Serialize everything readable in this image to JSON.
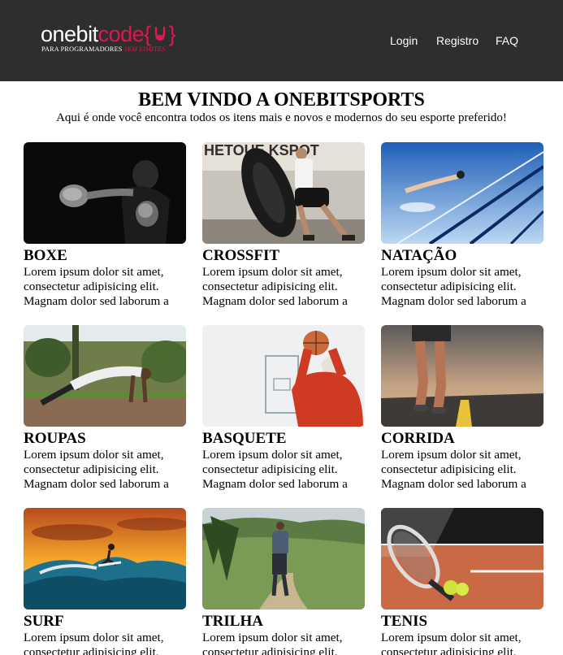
{
  "brand": {
    "logo_one": "onebit",
    "logo_code": "code",
    "logo_brace_open": "{",
    "logo_brace_close": "}",
    "tagline_main": "PARA PROGRAMADORES",
    "tagline_accent": "SEM LIMITES",
    "accent_color": "#e0174f"
  },
  "nav": {
    "login": "Login",
    "registro": "Registro",
    "faq": "FAQ"
  },
  "hero": {
    "title": "BEM VINDO A ONEBITSPORTS",
    "subtitle": "Aqui é onde você encontra todos os itens mais e novos e modernos do seu esporte preferido!"
  },
  "cards": [
    {
      "title": "BOXE",
      "text": "Lorem ipsum dolor sit amet,\nconsectetur adipisicing elit.\nMagnam dolor sed laborum a",
      "image": "boxing-photo"
    },
    {
      "title": "CROSSFIT",
      "text": "Lorem ipsum dolor sit amet,\nconsectetur adipisicing elit.\nMagnam dolor sed laborum a",
      "image": "crossfit-tire-photo"
    },
    {
      "title": "NATAÇÃO",
      "text": "Lorem ipsum dolor sit amet,\nconsectetur adipisicing elit.\nMagnam dolor sed laborum a",
      "image": "swimming-pool-photo"
    },
    {
      "title": "ROUPAS",
      "text": "Lorem ipsum dolor sit amet,\nconsectetur adipisicing elit.\nMagnam dolor sed laborum a",
      "image": "pushup-outdoor-photo"
    },
    {
      "title": "BASQUETE",
      "text": "Lorem ipsum dolor sit amet,\nconsectetur adipisicing elit.\nMagnam dolor sed laborum a",
      "image": "basketball-photo"
    },
    {
      "title": "CORRIDA",
      "text": "Lorem ipsum dolor sit amet,\nconsectetur adipisicing elit.\nMagnam dolor sed laborum a",
      "image": "running-road-photo"
    },
    {
      "title": "SURF",
      "text": "Lorem ipsum dolor sit amet,\nconsectetur adipisicing elit.\nMagnam dolor sed laborum a",
      "image": "surf-sunset-photo"
    },
    {
      "title": "TRILHA",
      "text": "Lorem ipsum dolor sit amet,\nconsectetur adipisicing elit.\nMagnam dolor sed laborum a",
      "image": "hiking-trail-photo"
    },
    {
      "title": "TENIS",
      "text": "Lorem ipsum dolor sit amet,\nconsectetur adipisicing elit.\nMagnam dolor sed laborum a",
      "image": "tennis-racket-photo"
    }
  ]
}
